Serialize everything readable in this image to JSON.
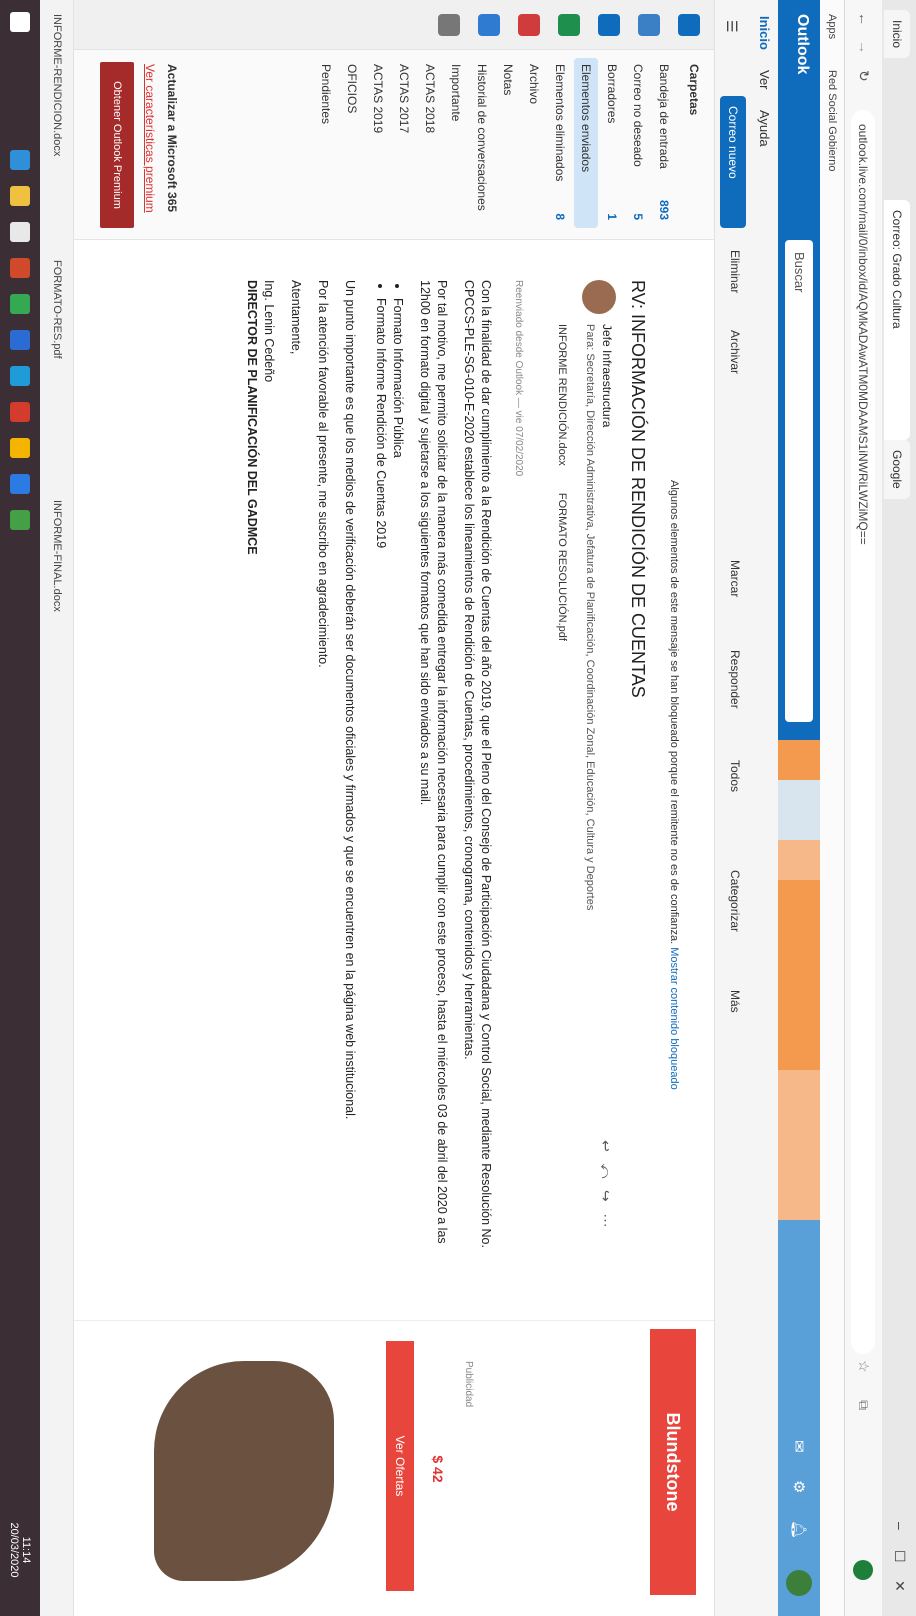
{
  "browser": {
    "tabs": [
      "Inicio",
      "Correo: Grado Cultura",
      "Google"
    ],
    "url": "outlook.live.com/mail/0/inbox/id/AQMkADAwATM0MDAAMS1iNWRiLWZiMQ==",
    "bookmarks": [
      "Apps",
      "Red Social Gobierno"
    ]
  },
  "outlook": {
    "logo": "Outlook",
    "search_placeholder": "Buscar"
  },
  "ribbon": {
    "tabs": [
      "Inicio",
      "Ver",
      "Ayuda"
    ],
    "new_mail": "Correo nuevo",
    "actions": [
      "Eliminar",
      "Archivar",
      "Marcar",
      "Responder",
      "Todos",
      "Categorizar",
      "Más"
    ]
  },
  "folders": {
    "title": "Carpetas",
    "items": [
      {
        "label": "Bandeja de entrada",
        "count": "893"
      },
      {
        "label": "Correo no deseado",
        "count": "5"
      },
      {
        "label": "Borradores",
        "count": "1"
      },
      {
        "label": "Elementos enviados",
        "count": ""
      },
      {
        "label": "Elementos eliminados",
        "count": "8"
      },
      {
        "label": "Archivo",
        "count": ""
      },
      {
        "label": "Notas",
        "count": ""
      },
      {
        "label": "Historial de conversaciones",
        "count": ""
      },
      {
        "label": "Importante",
        "count": ""
      },
      {
        "label": "ACTAS 2018",
        "count": ""
      },
      {
        "label": "ACTAS 2017",
        "count": ""
      },
      {
        "label": "ACTAS 2019",
        "count": ""
      },
      {
        "label": "OFICIOS",
        "count": ""
      },
      {
        "label": "Pendientes",
        "count": ""
      }
    ],
    "upgrade_title": "Actualizar a Microsoft 365",
    "upgrade_link": "Ver características premium",
    "upgrade_button": "Obtener Outlook Premium"
  },
  "message": {
    "notice_text": "Algunos elementos de este mensaje se han bloqueado porque el remitente no es de confianza.",
    "notice_link": "Mostrar contenido bloqueado",
    "subject": "RV: INFORMACIÓN DE RENDICIÓN DE CUENTAS",
    "sender": "Jefe Infraestructura",
    "recipients": "Para: Secretaría, Dirección Administrativa, Jefatura de Planificación, Coordinación Zonal, Educación, Cultura y Deportes",
    "attachments": [
      "INFORME RENDICIÓN.docx",
      "FORMATO RESOLUCIÓN.pdf"
    ],
    "forwarded_note": "Reenviado desde Outlook — vie 07/02/2020",
    "body_p1": "Con la finalidad de dar cumplimiento a la Rendición de Cuentas del año 2019, que el Pleno del Consejo de Participación Ciudadana y Control Social, mediante Resolución No. CPCCS-PLE-SG-010-E-2020 establece los lineamientos de Rendición de Cuentas, procedimientos, cronograma, contenidos y herramientas.",
    "body_p2": "Por tal motivo, me permito solicitar de la manera más comedida entregar la información necesaria para cumplir con este proceso, hasta el miércoles 03 de abril del 2020 a las 12h00 en formato digital y sujetarse a los siguientes formatos que han sido enviados a su mail.",
    "body_list": [
      "Formato Información Pública",
      "Formato Informe Rendición de Cuentas 2019"
    ],
    "body_p3": "Un punto importante es que los medios de verificación deberán ser documentos oficiales y firmados y que se encuentren en la página web institucional.",
    "body_p4": "Por la atención favorable al presente, me suscribo en agradecimiento.",
    "closing": "Atentamente,",
    "sig_name": "Ing. Lenin Cedeño",
    "sig_title": "DIRECTOR DE PLANIFICACIÓN DEL GADMCE"
  },
  "ad": {
    "brand": "Blundstone",
    "note": "Publicidad",
    "price": "$ 42",
    "cta": "Ver Ofertas"
  },
  "statusbar": {
    "left": "INFORME-RENDICION.docx",
    "mid": "FORMATO-RES.pdf",
    "right": "INFORME-FINAL.docx"
  },
  "taskbar": {
    "clock_time": "11:14",
    "clock_date": "20/03/2020"
  }
}
